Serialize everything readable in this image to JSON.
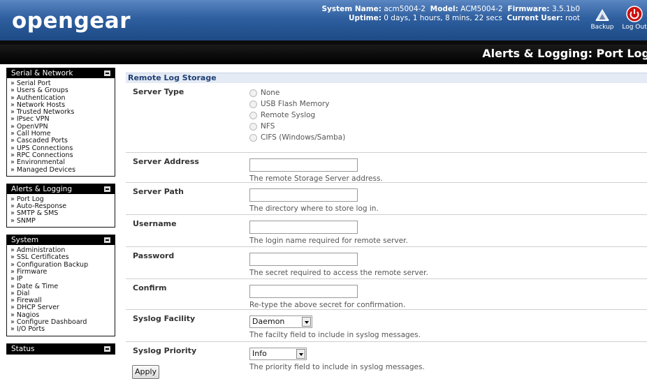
{
  "header": {
    "logo": "opengear",
    "system_name_label": "System Name:",
    "system_name": "acm5004-2",
    "model_label": "Model:",
    "model": "ACM5004-2",
    "firmware_label": "Firmware:",
    "firmware": "3.5.1b0",
    "uptime_label": "Uptime:",
    "uptime": "0 days, 1 hours, 8 mins, 22 secs",
    "user_label": "Current User:",
    "user": "root",
    "backup_label": "Backup",
    "logout_label": "Log Out"
  },
  "page_title": "Alerts & Logging: Port Log",
  "sidebar": {
    "sections": [
      {
        "title": "Serial & Network",
        "items": [
          "Serial Port",
          "Users & Groups",
          "Authentication",
          "Network Hosts",
          "Trusted Networks",
          "IPsec VPN",
          "OpenVPN",
          "Call Home",
          "Cascaded Ports",
          "UPS Connections",
          "RPC Connections",
          "Environmental",
          "Managed Devices"
        ]
      },
      {
        "title": "Alerts & Logging",
        "items": [
          "Port Log",
          "Auto-Response",
          "SMTP & SMS",
          "SNMP"
        ]
      },
      {
        "title": "System",
        "items": [
          "Administration",
          "SSL Certificates",
          "Configuration Backup",
          "Firmware",
          "IP",
          "Date & Time",
          "Dial",
          "Firewall",
          "DHCP Server",
          "Nagios",
          "Configure Dashboard",
          "I/O Ports"
        ]
      },
      {
        "title": "Status",
        "items": []
      }
    ]
  },
  "form": {
    "section_title": "Remote Log Storage",
    "server_type": {
      "label": "Server Type",
      "options": [
        "None",
        "USB Flash Memory",
        "Remote Syslog",
        "NFS",
        "CIFS (Windows/Samba)"
      ]
    },
    "server_address": {
      "label": "Server Address",
      "value": "",
      "hint": "The remote Storage Server address."
    },
    "server_path": {
      "label": "Server Path",
      "value": "",
      "hint": "The directory where to store log in."
    },
    "username": {
      "label": "Username",
      "value": "",
      "hint": "The login name required for remote server."
    },
    "password": {
      "label": "Password",
      "value": "",
      "hint": "The secret required to access the remote server."
    },
    "confirm": {
      "label": "Confirm",
      "value": "",
      "hint": "Re-type the above secret for confirmation."
    },
    "syslog_facility": {
      "label": "Syslog Facility",
      "selected": "Daemon",
      "hint": "The facilty field to include in syslog messages."
    },
    "syslog_priority": {
      "label": "Syslog Priority",
      "selected": "Info",
      "hint": "The priority field to include in syslog messages."
    },
    "apply_label": "Apply"
  },
  "colors": {
    "header_blue": "#2f5f9f",
    "section_bg": "#e4ebf5",
    "section_text": "#1f3f74",
    "logout_red": "#cc1111"
  },
  "icons": {
    "backup": "backup-icon",
    "logout": "power-icon"
  }
}
